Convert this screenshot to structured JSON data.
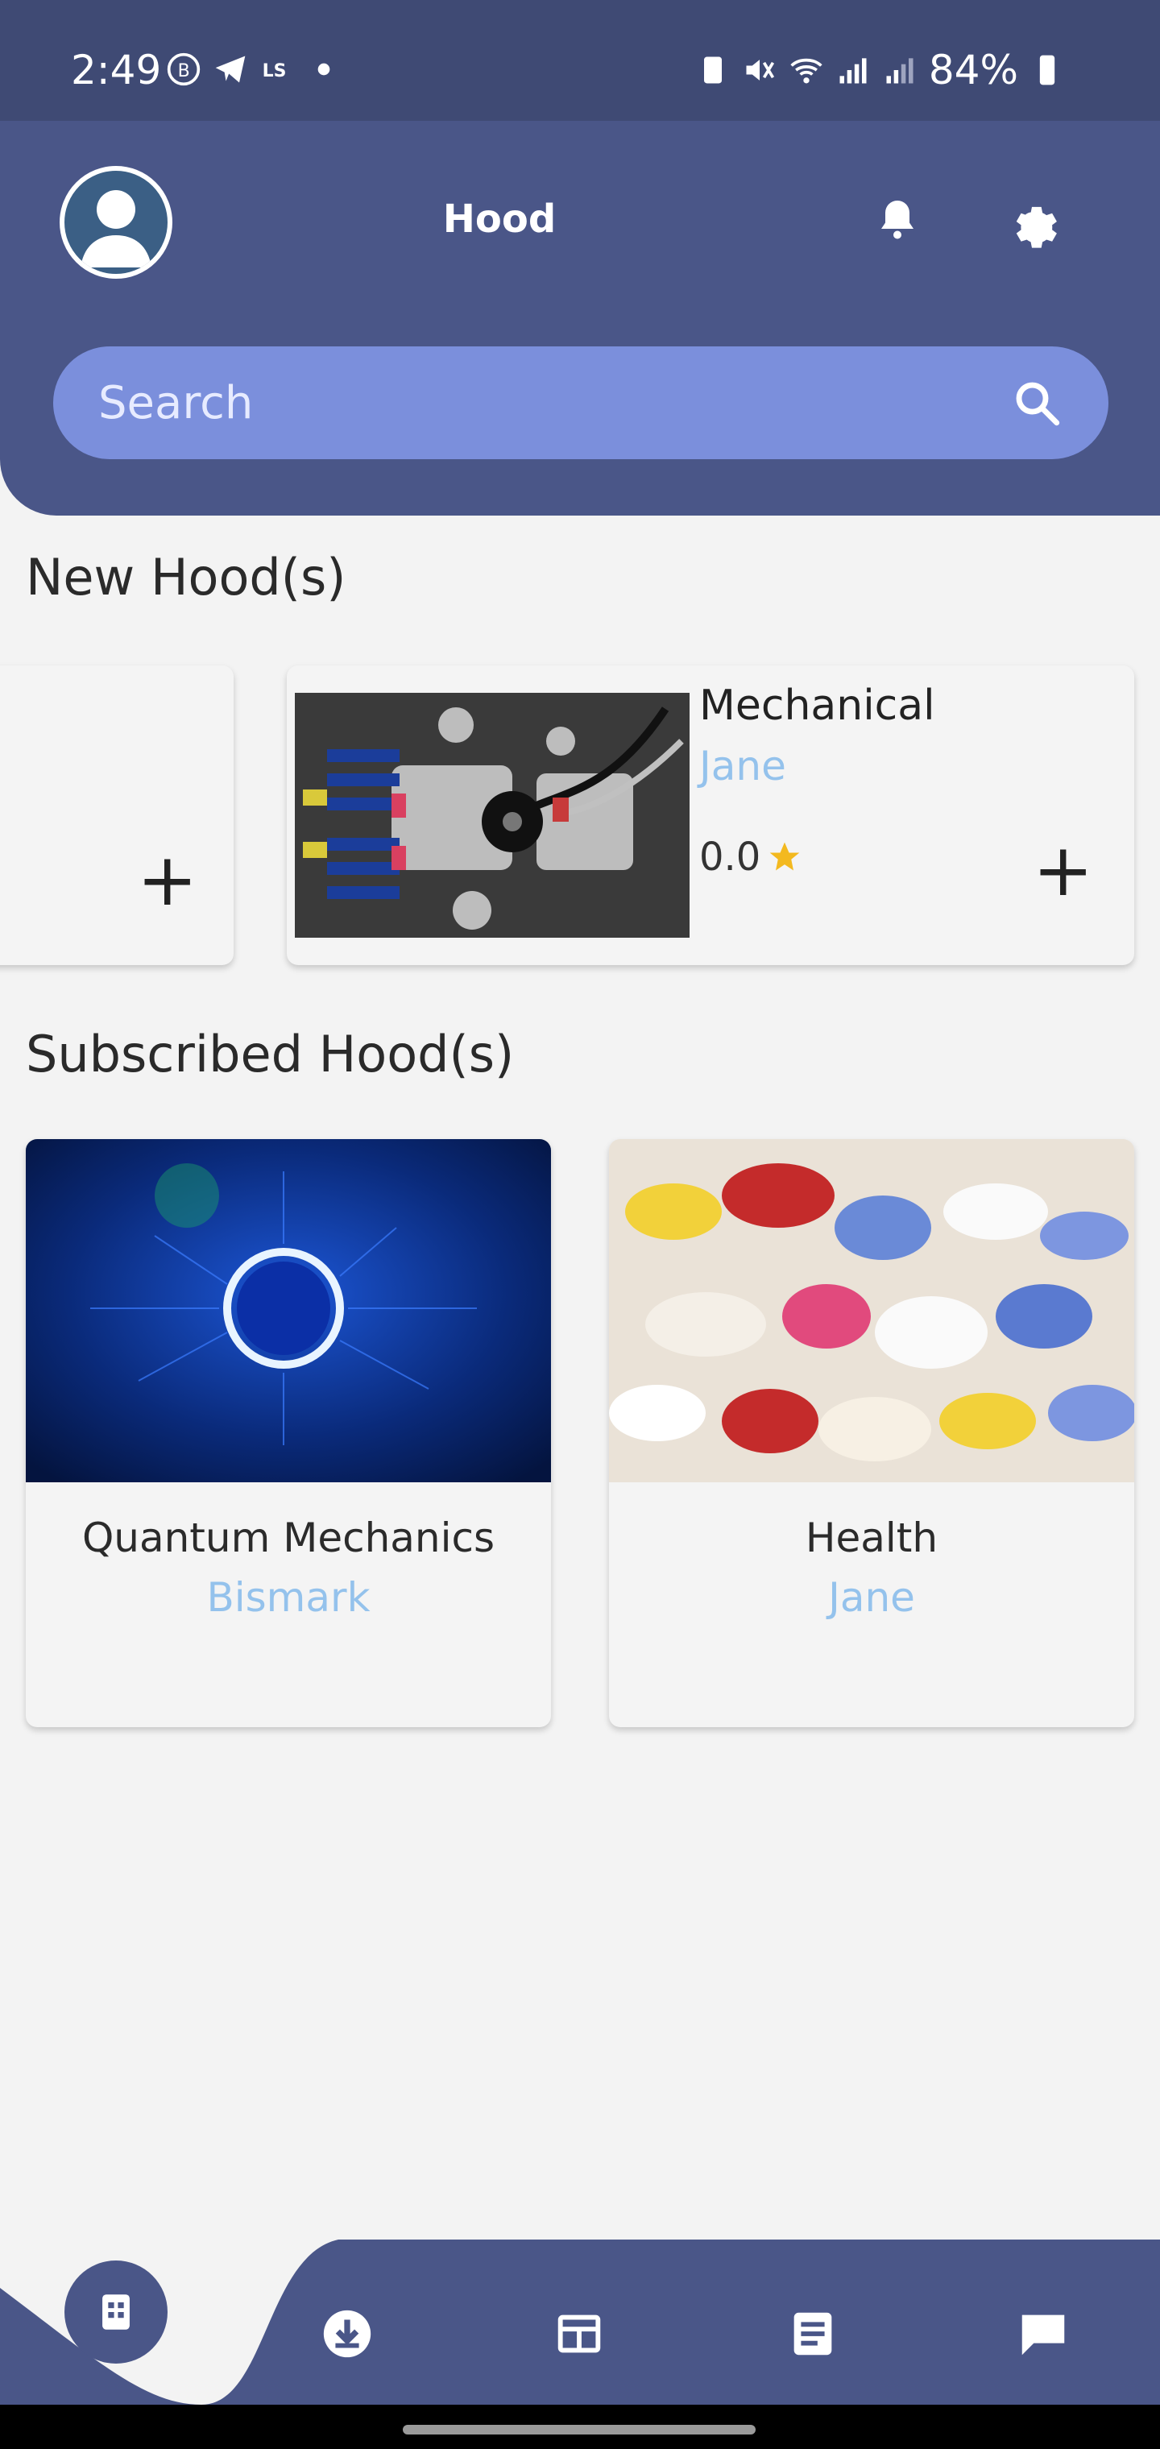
{
  "status_bar": {
    "time": "2:49",
    "battery": "84%",
    "left_icons": [
      "bereal-icon",
      "telegram-icon",
      "ls-icon",
      "dot-icon"
    ],
    "right_icons": [
      "battery-saver-icon",
      "mute-icon",
      "wifi-icon",
      "signal-icon",
      "signal-icon-2",
      "battery-icon"
    ]
  },
  "header": {
    "title": "Hood",
    "search_placeholder": "Search"
  },
  "new_section": {
    "title": "New Hood(s)",
    "cards": [
      {
        "title": "Mechanical",
        "author": "Jane",
        "rating": "0.0"
      }
    ]
  },
  "subscribed_section": {
    "title": "Subscribed Hood(s)",
    "cards": [
      {
        "title": "Quantum Mechanics",
        "author": "Bismark"
      },
      {
        "title": "Health",
        "author": "Jane"
      }
    ]
  },
  "colors": {
    "header": "#4a5688",
    "search": "#7b8fdc",
    "author": "#94c2ec",
    "star": "#f3b91f"
  }
}
